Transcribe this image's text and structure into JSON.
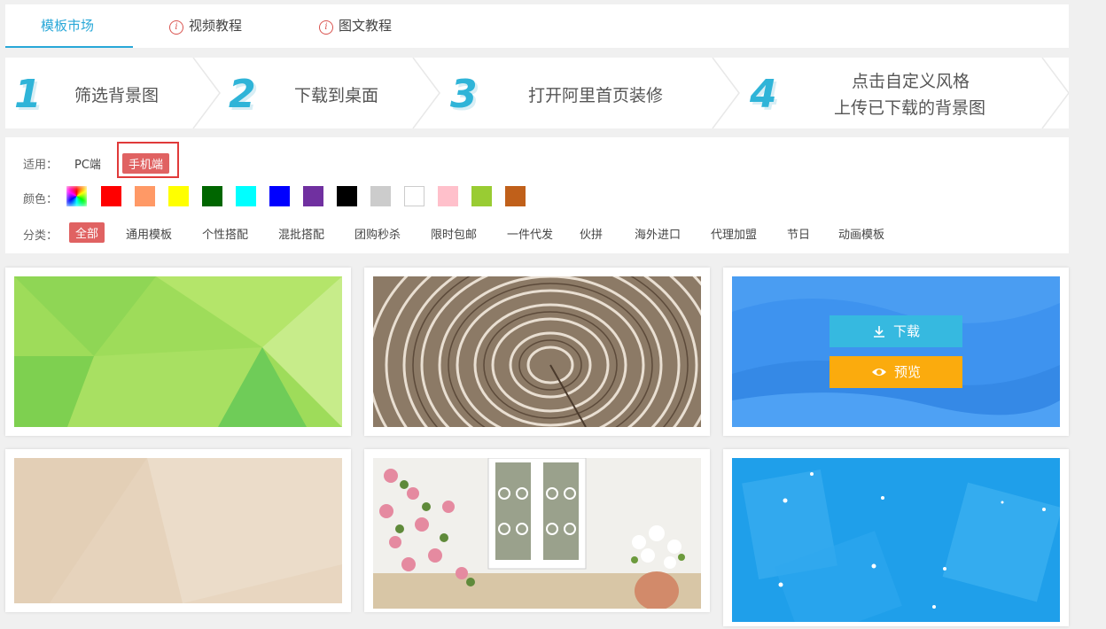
{
  "tabs": [
    {
      "label": "模板市场",
      "active": true
    },
    {
      "label": "视频教程",
      "icon": "info-icon"
    },
    {
      "label": "图文教程",
      "icon": "info-icon"
    }
  ],
  "steps": [
    {
      "num": "1",
      "text": "筛选背景图"
    },
    {
      "num": "2",
      "text": "下载到桌面"
    },
    {
      "num": "3",
      "text": "打开阿里首页装修"
    },
    {
      "num": "4",
      "line1": "点击自定义风格",
      "line2": "上传已下载的背景图"
    }
  ],
  "filters": {
    "apply_label": "适用：",
    "apply_options": [
      "PC端",
      "手机端"
    ],
    "apply_selected": "手机端",
    "color_label": "颜色：",
    "colors": [
      "rainbow",
      "#ff0000",
      "#ff9966",
      "#ffff00",
      "#006600",
      "#00ffff",
      "#0000ff",
      "#7030a0",
      "#000000",
      "#cccccc",
      "#ffffff",
      "#ffc0cb",
      "#99cc33",
      "#c0601a"
    ],
    "category_label": "分类：",
    "categories": [
      "全部",
      "通用模板",
      "个性搭配",
      "混批搭配",
      "团购秒杀",
      "限时包邮",
      "一件代发",
      "伙拼",
      "海外进口",
      "代理加盟",
      "节日",
      "动画模板"
    ],
    "category_selected": "全部"
  },
  "card_overlay": {
    "download": "下载",
    "preview": "预览"
  },
  "theme": {
    "accent": "#29a8d8",
    "active_red": "#e06262",
    "download_blue": "#36b9e0",
    "preview_orange": "#fbab0d"
  }
}
